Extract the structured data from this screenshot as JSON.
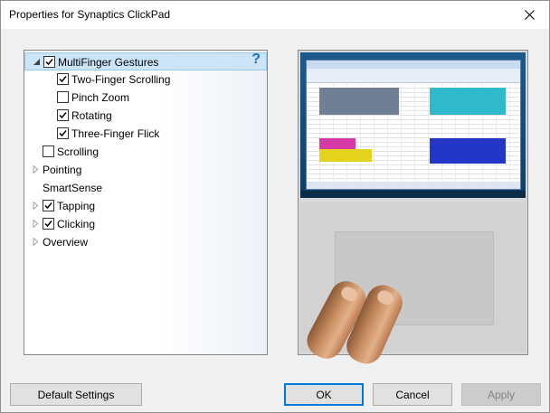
{
  "window": {
    "title": "Properties for Synaptics ClickPad"
  },
  "tree": {
    "items": [
      {
        "label": "MultiFinger Gestures",
        "level": 0,
        "expander": "expanded",
        "checkbox": true,
        "checked": true,
        "selected": true
      },
      {
        "label": "Two-Finger Scrolling",
        "level": 1,
        "expander": "none",
        "checkbox": true,
        "checked": true,
        "selected": false
      },
      {
        "label": "Pinch Zoom",
        "level": 1,
        "expander": "none",
        "checkbox": true,
        "checked": false,
        "selected": false
      },
      {
        "label": "Rotating",
        "level": 1,
        "expander": "none",
        "checkbox": true,
        "checked": true,
        "selected": false
      },
      {
        "label": "Three-Finger Flick",
        "level": 1,
        "expander": "none",
        "checkbox": true,
        "checked": true,
        "selected": false
      },
      {
        "label": "Scrolling",
        "level": 0,
        "expander": "none",
        "checkbox": true,
        "checked": false,
        "selected": false
      },
      {
        "label": "Pointing",
        "level": 0,
        "expander": "collapsed",
        "checkbox": false,
        "checked": false,
        "selected": false
      },
      {
        "label": "SmartSense",
        "level": 0,
        "expander": "none",
        "checkbox": false,
        "checked": false,
        "selected": false
      },
      {
        "label": "Tapping",
        "level": 0,
        "expander": "collapsed",
        "checkbox": true,
        "checked": true,
        "selected": false
      },
      {
        "label": "Clicking",
        "level": 0,
        "expander": "collapsed",
        "checkbox": true,
        "checked": true,
        "selected": false
      },
      {
        "label": "Overview",
        "level": 0,
        "expander": "collapsed",
        "checkbox": false,
        "checked": false,
        "selected": false
      }
    ],
    "help_icon": "question-mark-icon"
  },
  "buttons": {
    "default_settings": "Default Settings",
    "ok": "OK",
    "cancel": "Cancel",
    "apply": "Apply"
  },
  "colors": {
    "selection": "#cce4f7",
    "help_icon": "#1e6fc4",
    "default_button_border": "#0078d7"
  }
}
